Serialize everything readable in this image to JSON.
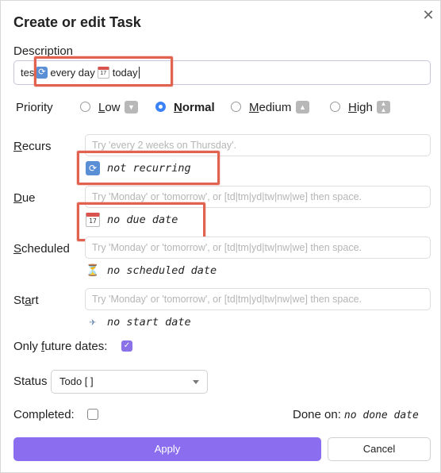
{
  "dialog": {
    "title": "Create or edit Task",
    "close_glyph": "✕"
  },
  "description": {
    "label": "Description",
    "value_prefix": "tes",
    "value_recur": "every day",
    "value_due": "today"
  },
  "priority": {
    "label": "Priority",
    "options": [
      {
        "first": "L",
        "rest": "ow",
        "selected": false,
        "icon": "low-priority-icon"
      },
      {
        "first": "N",
        "rest": "ormal",
        "selected": true,
        "icon": ""
      },
      {
        "first": "M",
        "rest": "edium",
        "selected": false,
        "icon": "medium-priority-icon"
      },
      {
        "first": "H",
        "rest": "igh",
        "selected": false,
        "icon": "high-priority-icon"
      }
    ]
  },
  "recurs": {
    "label_first": "R",
    "label_rest": "ecurs",
    "placeholder": "Try 'every 2 weeks on Thursday'.",
    "hint": "not recurring"
  },
  "due": {
    "label_first": "D",
    "label_rest": "ue",
    "placeholder": "Try 'Monday' or 'tomorrow', or [td|tm|yd|tw|nw|we] then space.",
    "hint": "no due date"
  },
  "scheduled": {
    "label_first": "S",
    "label_rest": "cheduled",
    "placeholder": "Try 'Monday' or 'tomorrow', or [td|tm|yd|tw|nw|we] then space.",
    "hint": "no scheduled date"
  },
  "start": {
    "label_pre": "St",
    "label_u": "a",
    "label_post": "rt",
    "placeholder": "Try 'Monday' or 'tomorrow', or [td|tm|yd|tw|nw|we] then space.",
    "hint": "no start date"
  },
  "future": {
    "label_pre": "Only ",
    "label_u": "f",
    "label_post": "uture dates:",
    "checked": true
  },
  "status": {
    "label": "Status",
    "selected": "Todo [ ]"
  },
  "completed": {
    "label": "Completed:",
    "checked": false,
    "done_on_label": "Done on:",
    "done_on_value": "no done date"
  },
  "buttons": {
    "apply": "Apply",
    "cancel": "Cancel"
  },
  "colors": {
    "accent": "#8b6ef0",
    "highlight": "#e0624f",
    "radio_selected": "#3b82f6"
  }
}
